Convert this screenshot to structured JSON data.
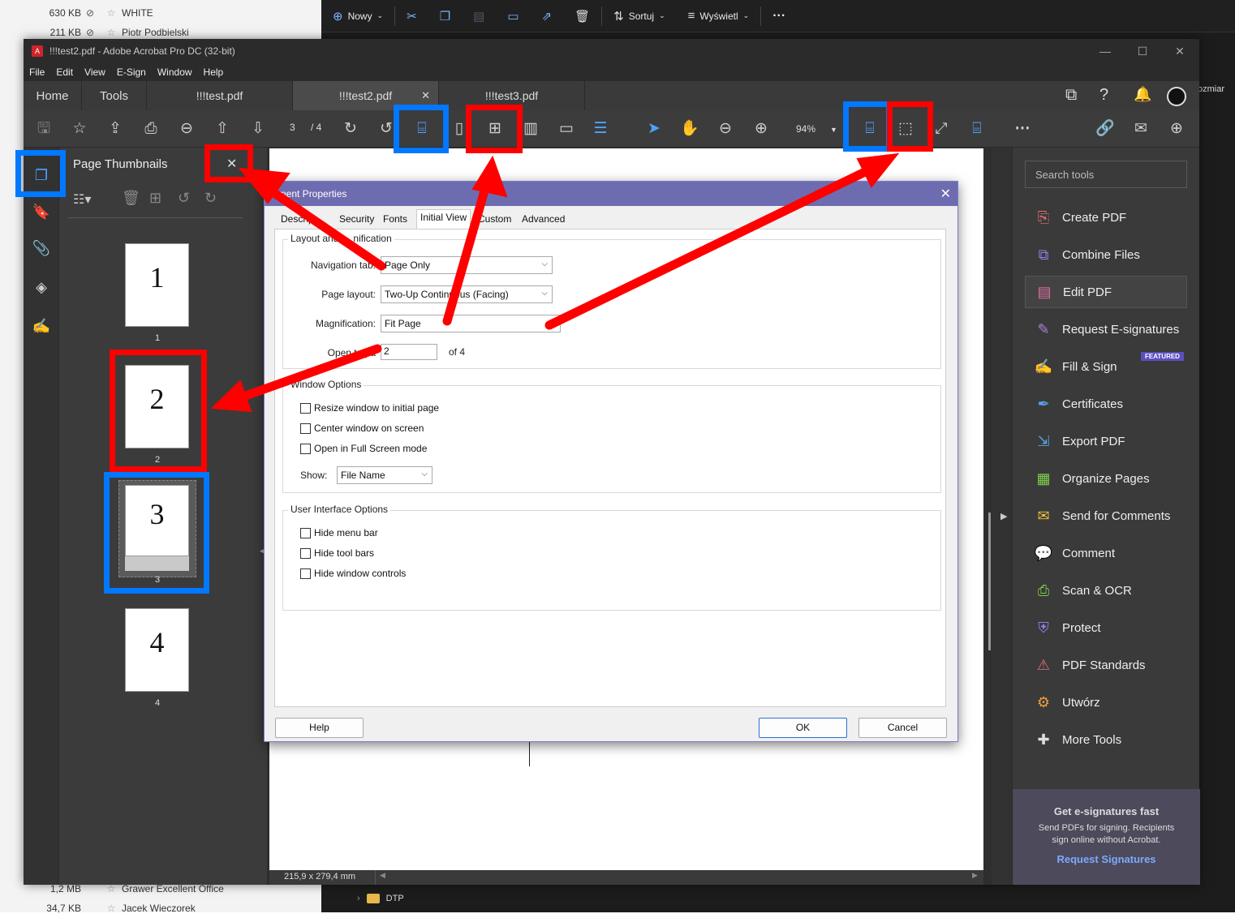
{
  "explorer": {
    "top_rows": [
      {
        "size": "630 KB",
        "name": "WHITE"
      },
      {
        "size": "211 KB",
        "name": "Piotr Podbielski"
      }
    ],
    "bottom_rows": [
      {
        "size": "1,2 MB",
        "name": "Grawer Excellent Office"
      },
      {
        "size": "34,7 KB",
        "name": "Jacek Wieczorek"
      }
    ],
    "toolbar": {
      "new_label": "Nowy",
      "sort_label": "Sortuj",
      "view_label": "Wyświetl",
      "more_label": "···"
    },
    "folder": "DTP",
    "size_column_fragment": "ozmiar"
  },
  "window": {
    "title": "!!!test2.pdf - Adobe Acrobat Pro DC (32-bit)",
    "menu": [
      "File",
      "Edit",
      "View",
      "E-Sign",
      "Window",
      "Help"
    ],
    "nav": {
      "home": "Home",
      "tools": "Tools"
    },
    "tabs": [
      "!!!test.pdf",
      "!!!test2.pdf",
      "!!!test3.pdf"
    ],
    "page_current": "3",
    "page_total": "/ 4",
    "zoom": "94%"
  },
  "thumbnails": {
    "title": "Page Thumbnails",
    "pages": [
      {
        "big": "1",
        "label": "1"
      },
      {
        "big": "2",
        "label": "2"
      },
      {
        "big": "3",
        "label": "3"
      },
      {
        "big": "4",
        "label": "4"
      }
    ]
  },
  "status": {
    "page_size": "215,9 x 279,4 mm"
  },
  "tools_panel": {
    "search_placeholder": "Search tools",
    "featured_badge": "FEATURED",
    "items": [
      {
        "label": "Create PDF",
        "icon": "create-pdf-icon",
        "color": "#e07070"
      },
      {
        "label": "Combine Files",
        "icon": "combine-files-icon",
        "color": "#8f7fe8"
      },
      {
        "label": "Edit PDF",
        "icon": "edit-pdf-icon",
        "color": "#e06fa0"
      },
      {
        "label": "Request E-signatures",
        "icon": "request-esign-icon",
        "color": "#b07fe0"
      },
      {
        "label": "Fill & Sign",
        "icon": "fill-sign-icon",
        "color": "#b07fe0"
      },
      {
        "label": "Certificates",
        "icon": "certificates-icon",
        "color": "#5aa0e8"
      },
      {
        "label": "Export PDF",
        "icon": "export-pdf-icon",
        "color": "#5aa0e8"
      },
      {
        "label": "Organize Pages",
        "icon": "organize-pages-icon",
        "color": "#7ed04a"
      },
      {
        "label": "Send for Comments",
        "icon": "send-comments-icon",
        "color": "#f0c040"
      },
      {
        "label": "Comment",
        "icon": "comment-icon",
        "color": "#f0c040"
      },
      {
        "label": "Scan & OCR",
        "icon": "scan-ocr-icon",
        "color": "#7ed04a"
      },
      {
        "label": "Protect",
        "icon": "protect-icon",
        "color": "#8f7fe8"
      },
      {
        "label": "PDF Standards",
        "icon": "pdf-standards-icon",
        "color": "#e07070"
      },
      {
        "label": "Utwórz",
        "icon": "create-icon",
        "color": "#f0a040"
      },
      {
        "label": "More Tools",
        "icon": "more-tools-icon",
        "color": "#dddddd"
      }
    ],
    "promo": {
      "title": "Get e-signatures fast",
      "body": "Send PDFs for signing. Recipients sign online without Acrobat.",
      "link": "Request Signatures"
    }
  },
  "dialog": {
    "title": "ument Properties",
    "tabs": [
      "Descrip",
      "Security",
      "Fonts",
      "Initial View",
      "Custom",
      "Advanced"
    ],
    "active_tab": "Initial View",
    "layout_group": "Layout and",
    "layout_group_tail": "nification",
    "nav_tab_label": "Navigation tab:",
    "nav_tab_value": "Page Only",
    "page_layout_label": "Page layout:",
    "page_layout_value": "Two-Up Continuous (Facing)",
    "magnification_label": "Magnification:",
    "magnification_value": "Fit Page",
    "open_to_label": "Open to pa",
    "open_to_value": "2",
    "of_label": "of 4",
    "window_group": "Window Options",
    "window_options": [
      "Resize window to initial page",
      "Center window on screen",
      "Open in Full Screen mode"
    ],
    "show_label": "Show:",
    "show_value": "File Name",
    "ui_group": "User Interface Options",
    "ui_options": [
      "Hide menu bar",
      "Hide tool bars",
      "Hide window controls"
    ],
    "help": "Help",
    "ok": "OK",
    "cancel": "Cancel"
  },
  "colors": {
    "annotation_red": "#ff0000",
    "annotation_blue": "#0078ff",
    "dialog_title": "#6e6cb0"
  }
}
